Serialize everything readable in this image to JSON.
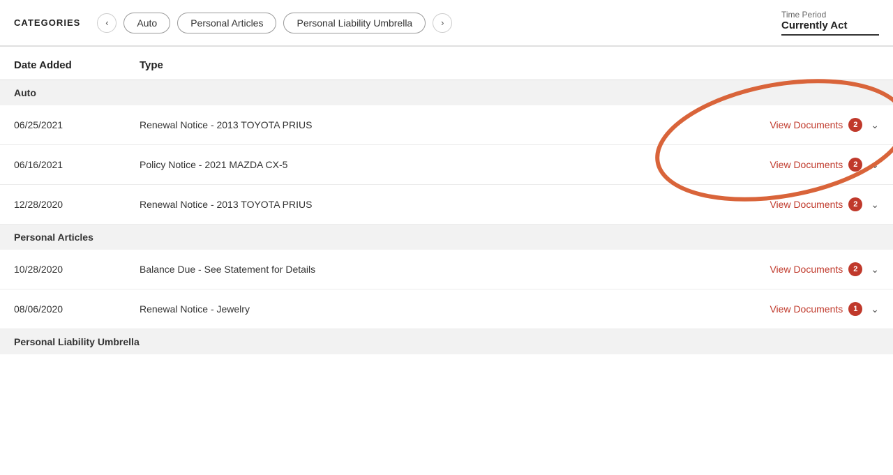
{
  "header": {
    "categories_label": "CATEGORIES",
    "prev_arrow": "‹",
    "next_arrow": "›",
    "tabs": [
      {
        "label": "Auto"
      },
      {
        "label": "Personal Articles"
      },
      {
        "label": "Personal Liability Umbrella"
      }
    ],
    "time_period": {
      "label": "Time Period",
      "value": "Currently Act"
    }
  },
  "table": {
    "col_date_header": "Date Added",
    "col_type_header": "Type",
    "sections": [
      {
        "section_name": "Auto",
        "rows": [
          {
            "date": "06/25/2021",
            "type": "Renewal Notice - 2013 TOYOTA PRIUS",
            "action_label": "View Documents",
            "badge_count": "2"
          },
          {
            "date": "06/16/2021",
            "type": "Policy Notice - 2021 MAZDA CX-5",
            "action_label": "View Documents",
            "badge_count": "2"
          },
          {
            "date": "12/28/2020",
            "type": "Renewal Notice - 2013 TOYOTA PRIUS",
            "action_label": "View Documents",
            "badge_count": "2"
          }
        ]
      },
      {
        "section_name": "Personal Articles",
        "rows": [
          {
            "date": "10/28/2020",
            "type": "Balance Due - See Statement for Details",
            "action_label": "View Documents",
            "badge_count": "2"
          },
          {
            "date": "08/06/2020",
            "type": "Renewal Notice - Jewelry",
            "action_label": "View Documents",
            "badge_count": "1"
          }
        ]
      },
      {
        "section_name": "Personal Liability Umbrella",
        "rows": []
      }
    ]
  },
  "ellipse_color": "#d9643a"
}
